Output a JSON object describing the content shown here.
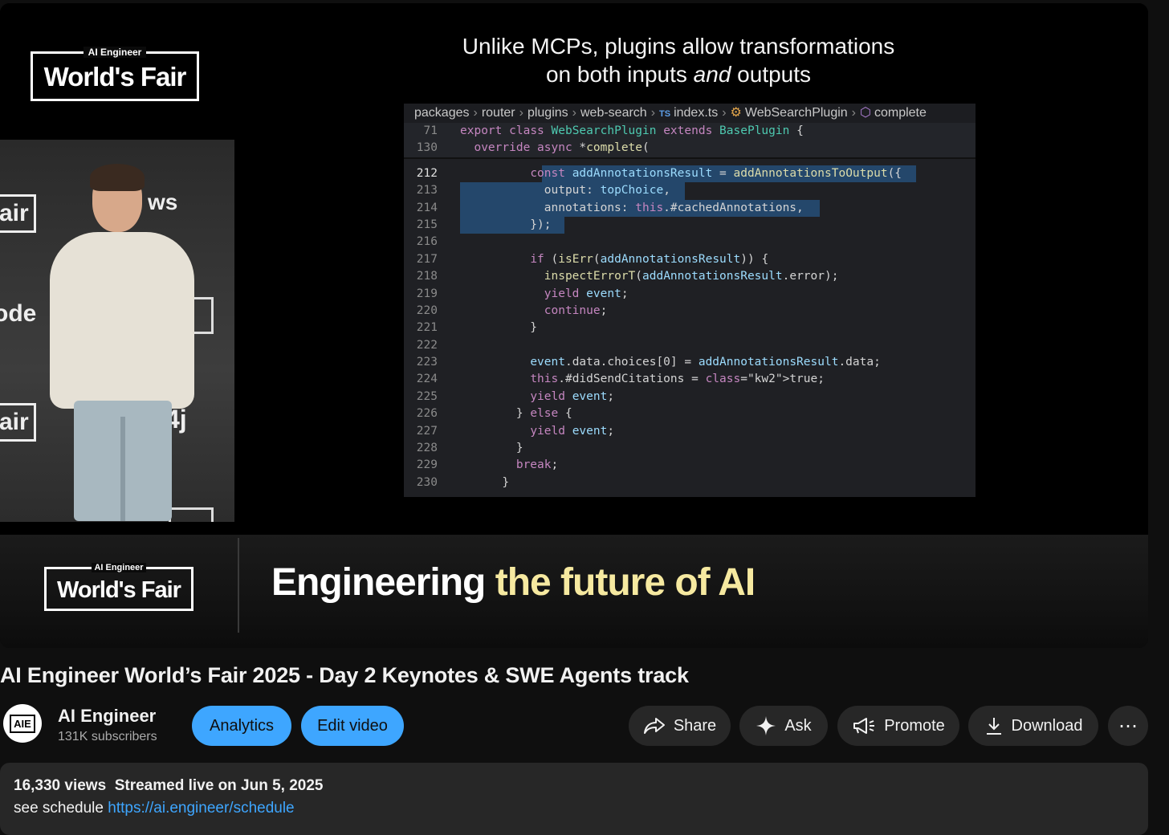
{
  "slide": {
    "logo_small": "AI Engineer",
    "logo_big": "World's Fair",
    "title_line1": "Unlike MCPs, plugins allow transformations",
    "title_line2_a": "on both inputs ",
    "title_line2_em": "and",
    "title_line2_b": " outputs",
    "stage_signs": [
      "air",
      "ode",
      "air"
    ],
    "stage_text_right": [
      "ws",
      "4j"
    ]
  },
  "editor": {
    "breadcrumbs": [
      "packages",
      "router",
      "plugins",
      "web-search",
      "index.ts",
      "WebSearchPlugin",
      "complete"
    ],
    "sticky": [
      {
        "ln": "71",
        "text": "export class WebSearchPlugin extends BasePlugin {"
      },
      {
        "ln": "130",
        "text": "  override async *complete("
      }
    ],
    "lines": [
      {
        "ln": "212",
        "text": "          const addAnnotationsResult = addAnnotationsToOutput({"
      },
      {
        "ln": "213",
        "text": "            output: topChoice,"
      },
      {
        "ln": "214",
        "text": "            annotations: this.#cachedAnnotations,"
      },
      {
        "ln": "215",
        "text": "          });"
      },
      {
        "ln": "216",
        "text": ""
      },
      {
        "ln": "217",
        "text": "          if (isErr(addAnnotationsResult)) {"
      },
      {
        "ln": "218",
        "text": "            inspectErrorT(addAnnotationsResult.error);"
      },
      {
        "ln": "219",
        "text": "            yield event;"
      },
      {
        "ln": "220",
        "text": "            continue;"
      },
      {
        "ln": "221",
        "text": "          }"
      },
      {
        "ln": "222",
        "text": ""
      },
      {
        "ln": "223",
        "text": "          event.data.choices[0] = addAnnotationsResult.data;"
      },
      {
        "ln": "224",
        "text": "          this.#didSendCitations = true;"
      },
      {
        "ln": "225",
        "text": "          yield event;"
      },
      {
        "ln": "226",
        "text": "        } else {"
      },
      {
        "ln": "227",
        "text": "          yield event;"
      },
      {
        "ln": "228",
        "text": "        }"
      },
      {
        "ln": "229",
        "text": "        break;"
      },
      {
        "ln": "230",
        "text": "      }"
      }
    ]
  },
  "lower_third": {
    "logo_small": "AI Engineer",
    "logo_big": "World's Fair",
    "text_white": "Engineering ",
    "text_yellow": "the future of AI"
  },
  "video": {
    "title": "AI Engineer World’s Fair 2025 - Day 2 Keynotes & SWE Agents track"
  },
  "channel": {
    "avatar_text": "AIE",
    "name": "AI Engineer",
    "subscribers": "131K subscribers"
  },
  "actions": {
    "analytics": "Analytics",
    "edit_video": "Edit video",
    "share": "Share",
    "ask": "Ask",
    "promote": "Promote",
    "download": "Download",
    "more": "⋯"
  },
  "description": {
    "views": "16,330 views",
    "streamed": "Streamed live on Jun 5, 2025",
    "schedule_label": "see schedule ",
    "schedule_link": "https://ai.engineer/schedule"
  },
  "colors": {
    "accent_blue": "#3ea6ff",
    "pill_bg": "#272727",
    "page_bg": "#0f0f0f",
    "lower_third_yellow": "#f6e9a0"
  }
}
